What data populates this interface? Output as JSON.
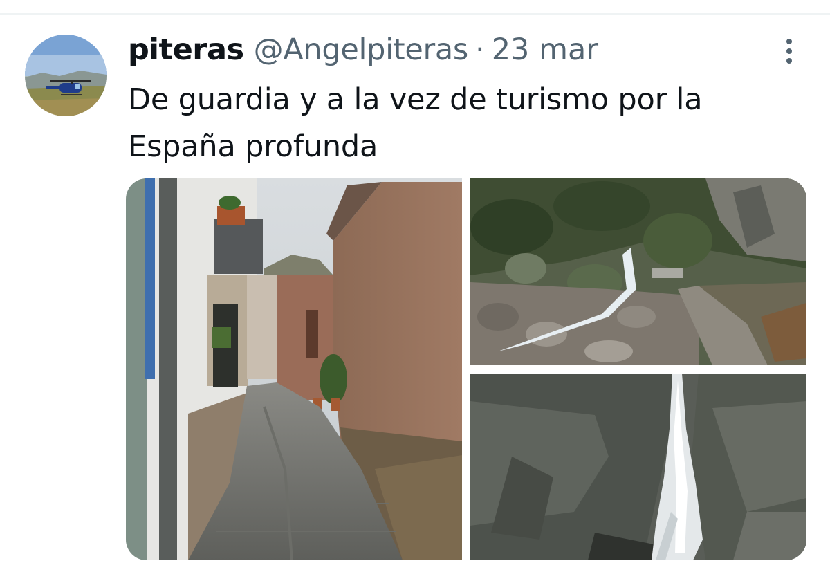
{
  "tweet": {
    "display_name": "piteras",
    "handle": "@Angelpiteras",
    "separator": "·",
    "date": "23 mar",
    "text": "De guardia y a la vez de turismo por la España profunda"
  },
  "icons": {
    "more": "more-vertical-icon"
  },
  "colors": {
    "text_primary": "#0f1419",
    "text_secondary": "#536471",
    "divider": "#eff3f4"
  }
}
